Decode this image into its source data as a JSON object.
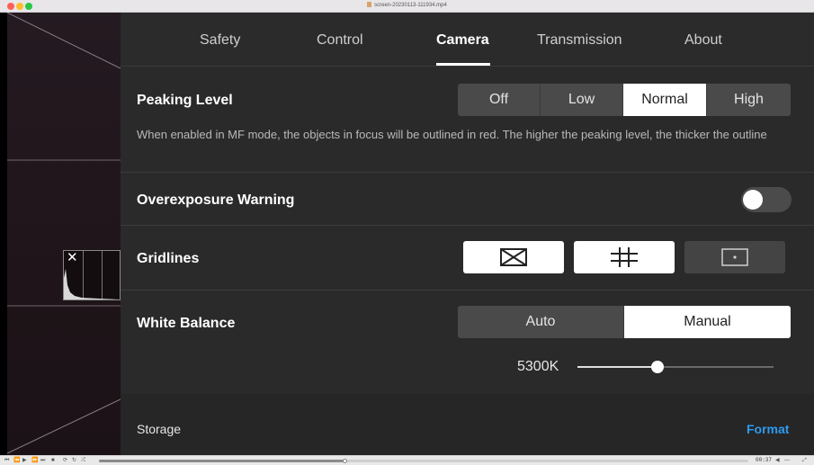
{
  "window": {
    "title": "screen-20230113-111934.mp4"
  },
  "tabs": [
    {
      "label": "Safety",
      "active": false
    },
    {
      "label": "Control",
      "active": false
    },
    {
      "label": "Camera",
      "active": true
    },
    {
      "label": "Transmission",
      "active": false
    },
    {
      "label": "About",
      "active": false
    }
  ],
  "peaking": {
    "label": "Peaking Level",
    "options": [
      "Off",
      "Low",
      "Normal",
      "High"
    ],
    "selected": "Normal",
    "description": "When enabled in MF mode, the objects in focus will be outlined in red. The higher the peaking level, the thicker the outline"
  },
  "overexposure": {
    "label": "Overexposure Warning",
    "enabled": false
  },
  "gridlines": {
    "label": "Gridlines",
    "options": [
      "diagonal-grid-icon",
      "nine-grid-icon",
      "center-point-icon"
    ],
    "selected": [
      "diagonal-grid-icon",
      "nine-grid-icon"
    ]
  },
  "white_balance": {
    "label": "White Balance",
    "options": [
      "Auto",
      "Manual"
    ],
    "selected": "Manual",
    "kelvin_value": "5300K",
    "slider_fraction": 0.41
  },
  "storage": {
    "label": "Storage",
    "action": "Format"
  },
  "player": {
    "current_time": "00:37",
    "progress_fraction": 0.38,
    "volume_icon": "speaker-icon"
  },
  "colors": {
    "panel_bg": "#2a2a2a",
    "accent_link": "#2d9bf0",
    "selected_segment": "#ffffff"
  }
}
